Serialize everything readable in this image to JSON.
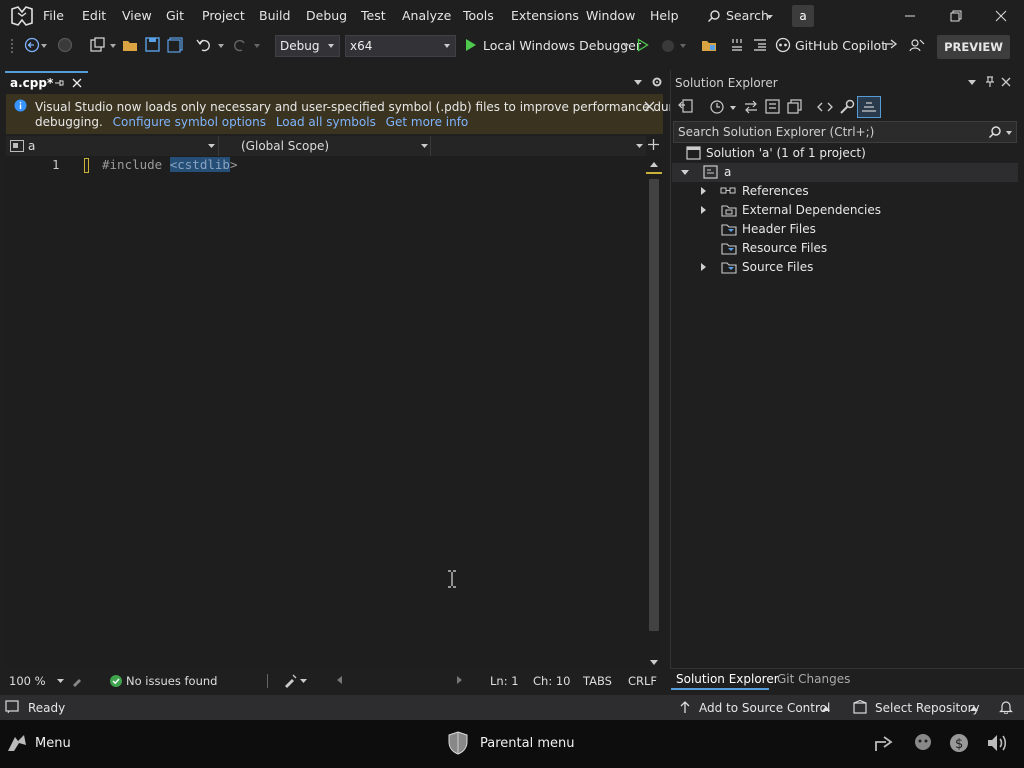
{
  "menu": {
    "items": [
      "File",
      "Edit",
      "View",
      "Git",
      "Project",
      "Build",
      "Debug",
      "Test",
      "Analyze",
      "Tools",
      "Extensions",
      "Window",
      "Help"
    ],
    "search_label": "Search",
    "user_initial": "a"
  },
  "toolbar": {
    "config": "Debug",
    "platform": "x64",
    "run_label": "Local Windows Debugger",
    "copilot_label": "GitHub Copilot",
    "preview_label": "PREVIEW"
  },
  "editor": {
    "tab_label": "a.cpp*",
    "info_message": "Visual Studio now loads only necessary and user-specified symbol (.pdb) files to improve performance during",
    "info_message_cont": "debugging.",
    "info_links": [
      "Configure symbol options",
      "Load all symbols",
      "Get more info"
    ],
    "nav_project": "a",
    "nav_scope": "(Global Scope)",
    "line_number": "1",
    "code_keyword": "#include ",
    "code_selected": "<cstdlib",
    "code_rest": ">",
    "zoom": "100 %",
    "issues": "No issues found",
    "ln": "Ln: 1",
    "ch": "Ch: 10",
    "indent": "TABS",
    "eol": "CRLF"
  },
  "solution_explorer": {
    "title": "Solution Explorer",
    "search_placeholder": "Search Solution Explorer (Ctrl+;)",
    "solution_label": "Solution 'a' (1 of 1 project)",
    "project_label": "a",
    "items": [
      {
        "label": "References",
        "expandable": true
      },
      {
        "label": "External Dependencies",
        "expandable": true
      },
      {
        "label": "Header Files",
        "expandable": false
      },
      {
        "label": "Resource Files",
        "expandable": false
      },
      {
        "label": "Source Files",
        "expandable": true
      }
    ],
    "tabs": [
      "Solution Explorer",
      "Git Changes"
    ]
  },
  "statusbar": {
    "ready": "Ready",
    "source_control": "Add to Source Control",
    "repository": "Select Repository"
  },
  "taskbar": {
    "menu_label": "Menu",
    "parental_label": "Parental menu"
  },
  "colors": {
    "accent": "#569cd6",
    "info_bg": "#3a3320",
    "link": "#7fb4ff",
    "run_green": "#4ec94e",
    "selection": "#264f78"
  }
}
